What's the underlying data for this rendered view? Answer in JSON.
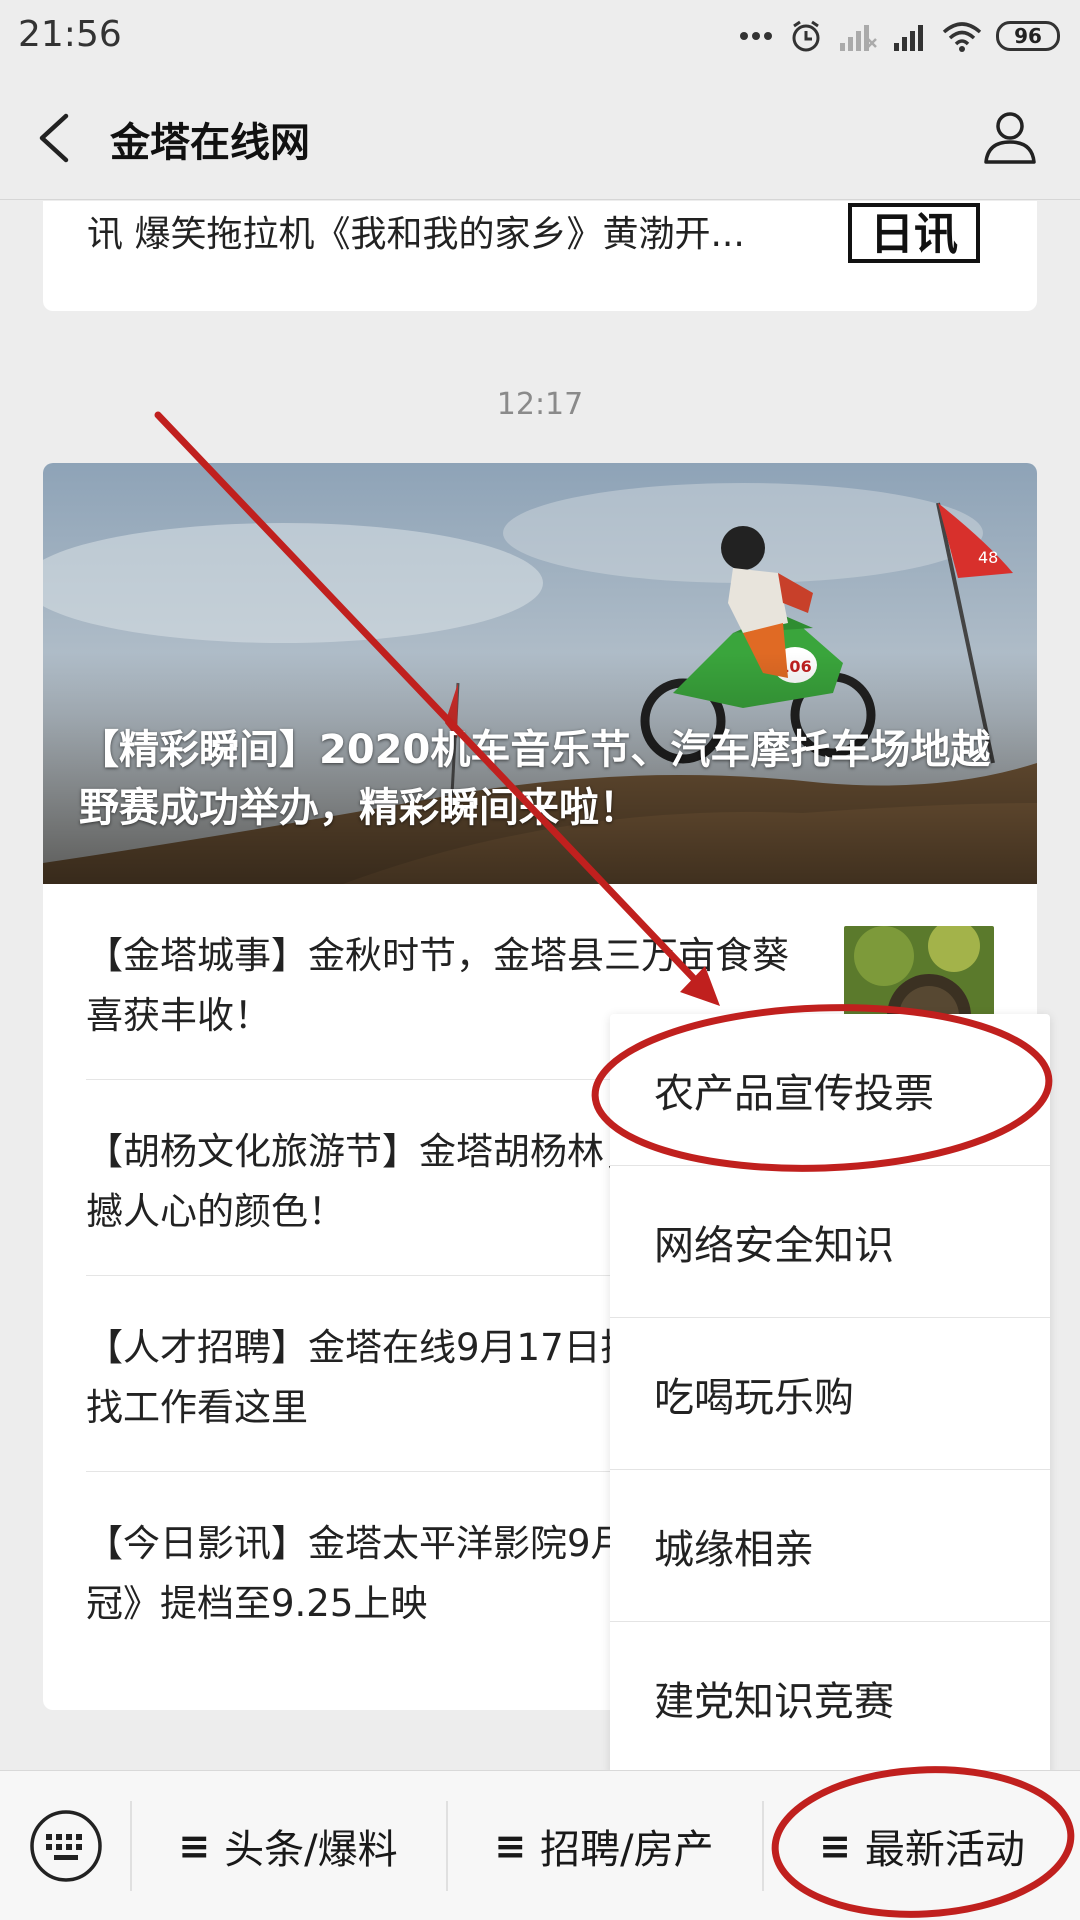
{
  "status_bar": {
    "time": "21:56",
    "battery": "96",
    "icons": [
      "dots-icon",
      "alarm-icon",
      "signal-weak-icon",
      "signal-icon",
      "wifi-icon",
      "battery-icon"
    ]
  },
  "nav": {
    "title": "金塔在线网",
    "back_icon": "back-arrow-icon",
    "user_icon": "user-profile-icon"
  },
  "top_card": {
    "text": "讯 爆笑拖拉机《我和我的家乡》黄渤开...",
    "thumb_text": "日讯"
  },
  "timestamp": "12:17",
  "hero": {
    "title": "【精彩瞬间】2020机车音乐节、汽车摩托车场地越野赛成功举办，精彩瞬间来啦！",
    "flag_text": "48",
    "bike_number": "106"
  },
  "articles": [
    {
      "text": "【金塔城事】金秋时节，金塔县三万亩食葵喜获丰收！"
    },
    {
      "text": "【胡杨文化旅游节】金塔胡杨林，秋天最震撼人心的颜色！"
    },
    {
      "text": "【人才招聘】金塔在线9月17日招聘信息，找工作看这里"
    },
    {
      "text": "【今日影讯】金塔太平洋影院9月影讯，《夺冠》提档至9.25上映"
    }
  ],
  "popup_menu": {
    "items": [
      {
        "label": "农产品宣传投票"
      },
      {
        "label": "网络安全知识"
      },
      {
        "label": "吃喝玩乐购"
      },
      {
        "label": "城缘相亲"
      },
      {
        "label": "建党知识竞赛"
      }
    ]
  },
  "bottom_menu": {
    "keyboard_icon": "keyboard-icon",
    "hamburger": "≡",
    "items": [
      {
        "label": "头条/爆料"
      },
      {
        "label": "招聘/房产"
      },
      {
        "label": "最新活动"
      }
    ]
  },
  "colors": {
    "annotation_red": "#c0201e",
    "page_bg": "#ededed"
  }
}
